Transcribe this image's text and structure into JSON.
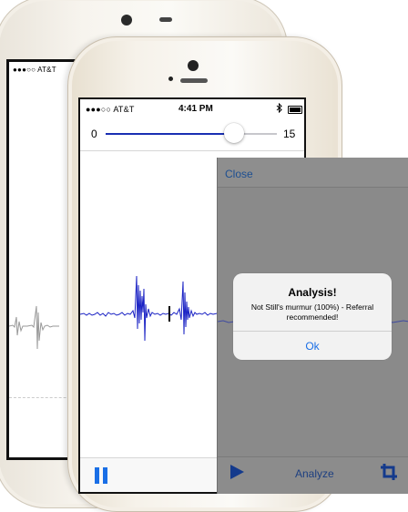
{
  "back_phone": {
    "status_carrier": "●●●○○ AT&T"
  },
  "front_phone": {
    "status_bar": {
      "carrier": "●●●○○ AT&T",
      "time": "4:41 PM",
      "bluetooth_icon": "bluetooth-icon",
      "battery_icon": "battery-icon"
    },
    "slider": {
      "min_label": "0",
      "max_label": "15",
      "value_fraction": 0.75
    },
    "toolbar": {
      "pause_icon": "pause-icon"
    }
  },
  "overlay": {
    "close_label": "Close",
    "toolbar": {
      "play_icon": "play-icon",
      "analyze_label": "Analyze",
      "crop_icon": "crop-icon"
    }
  },
  "alert": {
    "title": "Analysis!",
    "message": "Not Still's murmur (100%) - Referral recommended!",
    "ok_label": "Ok"
  },
  "colors": {
    "accent_blue": "#1a6fe6",
    "slider_fill": "#1a2fb3",
    "waveform": "#1a22c4",
    "overlay_gray": "#8a8a8a"
  }
}
